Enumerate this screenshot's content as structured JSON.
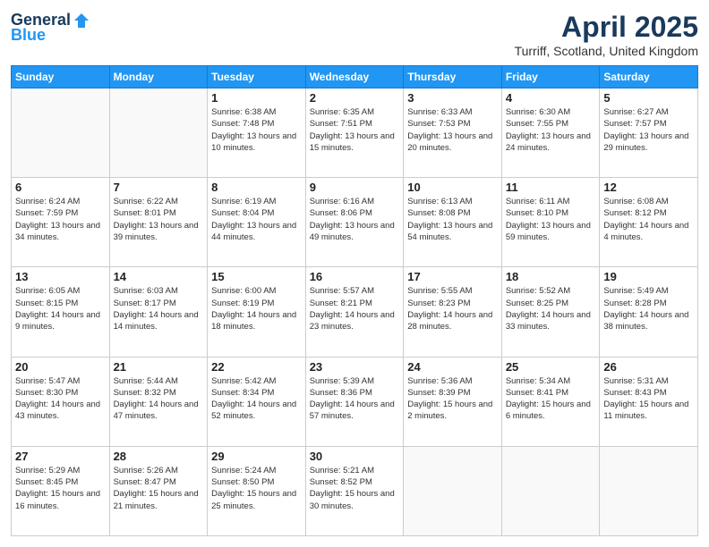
{
  "logo": {
    "general": "General",
    "blue": "Blue"
  },
  "header": {
    "title": "April 2025",
    "location": "Turriff, Scotland, United Kingdom"
  },
  "weekdays": [
    "Sunday",
    "Monday",
    "Tuesday",
    "Wednesday",
    "Thursday",
    "Friday",
    "Saturday"
  ],
  "weeks": [
    [
      {
        "day": "",
        "sunrise": "",
        "sunset": "",
        "daylight": ""
      },
      {
        "day": "",
        "sunrise": "",
        "sunset": "",
        "daylight": ""
      },
      {
        "day": "1",
        "sunrise": "Sunrise: 6:38 AM",
        "sunset": "Sunset: 7:48 PM",
        "daylight": "Daylight: 13 hours and 10 minutes."
      },
      {
        "day": "2",
        "sunrise": "Sunrise: 6:35 AM",
        "sunset": "Sunset: 7:51 PM",
        "daylight": "Daylight: 13 hours and 15 minutes."
      },
      {
        "day": "3",
        "sunrise": "Sunrise: 6:33 AM",
        "sunset": "Sunset: 7:53 PM",
        "daylight": "Daylight: 13 hours and 20 minutes."
      },
      {
        "day": "4",
        "sunrise": "Sunrise: 6:30 AM",
        "sunset": "Sunset: 7:55 PM",
        "daylight": "Daylight: 13 hours and 24 minutes."
      },
      {
        "day": "5",
        "sunrise": "Sunrise: 6:27 AM",
        "sunset": "Sunset: 7:57 PM",
        "daylight": "Daylight: 13 hours and 29 minutes."
      }
    ],
    [
      {
        "day": "6",
        "sunrise": "Sunrise: 6:24 AM",
        "sunset": "Sunset: 7:59 PM",
        "daylight": "Daylight: 13 hours and 34 minutes."
      },
      {
        "day": "7",
        "sunrise": "Sunrise: 6:22 AM",
        "sunset": "Sunset: 8:01 PM",
        "daylight": "Daylight: 13 hours and 39 minutes."
      },
      {
        "day": "8",
        "sunrise": "Sunrise: 6:19 AM",
        "sunset": "Sunset: 8:04 PM",
        "daylight": "Daylight: 13 hours and 44 minutes."
      },
      {
        "day": "9",
        "sunrise": "Sunrise: 6:16 AM",
        "sunset": "Sunset: 8:06 PM",
        "daylight": "Daylight: 13 hours and 49 minutes."
      },
      {
        "day": "10",
        "sunrise": "Sunrise: 6:13 AM",
        "sunset": "Sunset: 8:08 PM",
        "daylight": "Daylight: 13 hours and 54 minutes."
      },
      {
        "day": "11",
        "sunrise": "Sunrise: 6:11 AM",
        "sunset": "Sunset: 8:10 PM",
        "daylight": "Daylight: 13 hours and 59 minutes."
      },
      {
        "day": "12",
        "sunrise": "Sunrise: 6:08 AM",
        "sunset": "Sunset: 8:12 PM",
        "daylight": "Daylight: 14 hours and 4 minutes."
      }
    ],
    [
      {
        "day": "13",
        "sunrise": "Sunrise: 6:05 AM",
        "sunset": "Sunset: 8:15 PM",
        "daylight": "Daylight: 14 hours and 9 minutes."
      },
      {
        "day": "14",
        "sunrise": "Sunrise: 6:03 AM",
        "sunset": "Sunset: 8:17 PM",
        "daylight": "Daylight: 14 hours and 14 minutes."
      },
      {
        "day": "15",
        "sunrise": "Sunrise: 6:00 AM",
        "sunset": "Sunset: 8:19 PM",
        "daylight": "Daylight: 14 hours and 18 minutes."
      },
      {
        "day": "16",
        "sunrise": "Sunrise: 5:57 AM",
        "sunset": "Sunset: 8:21 PM",
        "daylight": "Daylight: 14 hours and 23 minutes."
      },
      {
        "day": "17",
        "sunrise": "Sunrise: 5:55 AM",
        "sunset": "Sunset: 8:23 PM",
        "daylight": "Daylight: 14 hours and 28 minutes."
      },
      {
        "day": "18",
        "sunrise": "Sunrise: 5:52 AM",
        "sunset": "Sunset: 8:25 PM",
        "daylight": "Daylight: 14 hours and 33 minutes."
      },
      {
        "day": "19",
        "sunrise": "Sunrise: 5:49 AM",
        "sunset": "Sunset: 8:28 PM",
        "daylight": "Daylight: 14 hours and 38 minutes."
      }
    ],
    [
      {
        "day": "20",
        "sunrise": "Sunrise: 5:47 AM",
        "sunset": "Sunset: 8:30 PM",
        "daylight": "Daylight: 14 hours and 43 minutes."
      },
      {
        "day": "21",
        "sunrise": "Sunrise: 5:44 AM",
        "sunset": "Sunset: 8:32 PM",
        "daylight": "Daylight: 14 hours and 47 minutes."
      },
      {
        "day": "22",
        "sunrise": "Sunrise: 5:42 AM",
        "sunset": "Sunset: 8:34 PM",
        "daylight": "Daylight: 14 hours and 52 minutes."
      },
      {
        "day": "23",
        "sunrise": "Sunrise: 5:39 AM",
        "sunset": "Sunset: 8:36 PM",
        "daylight": "Daylight: 14 hours and 57 minutes."
      },
      {
        "day": "24",
        "sunrise": "Sunrise: 5:36 AM",
        "sunset": "Sunset: 8:39 PM",
        "daylight": "Daylight: 15 hours and 2 minutes."
      },
      {
        "day": "25",
        "sunrise": "Sunrise: 5:34 AM",
        "sunset": "Sunset: 8:41 PM",
        "daylight": "Daylight: 15 hours and 6 minutes."
      },
      {
        "day": "26",
        "sunrise": "Sunrise: 5:31 AM",
        "sunset": "Sunset: 8:43 PM",
        "daylight": "Daylight: 15 hours and 11 minutes."
      }
    ],
    [
      {
        "day": "27",
        "sunrise": "Sunrise: 5:29 AM",
        "sunset": "Sunset: 8:45 PM",
        "daylight": "Daylight: 15 hours and 16 minutes."
      },
      {
        "day": "28",
        "sunrise": "Sunrise: 5:26 AM",
        "sunset": "Sunset: 8:47 PM",
        "daylight": "Daylight: 15 hours and 21 minutes."
      },
      {
        "day": "29",
        "sunrise": "Sunrise: 5:24 AM",
        "sunset": "Sunset: 8:50 PM",
        "daylight": "Daylight: 15 hours and 25 minutes."
      },
      {
        "day": "30",
        "sunrise": "Sunrise: 5:21 AM",
        "sunset": "Sunset: 8:52 PM",
        "daylight": "Daylight: 15 hours and 30 minutes."
      },
      {
        "day": "",
        "sunrise": "",
        "sunset": "",
        "daylight": ""
      },
      {
        "day": "",
        "sunrise": "",
        "sunset": "",
        "daylight": ""
      },
      {
        "day": "",
        "sunrise": "",
        "sunset": "",
        "daylight": ""
      }
    ]
  ]
}
